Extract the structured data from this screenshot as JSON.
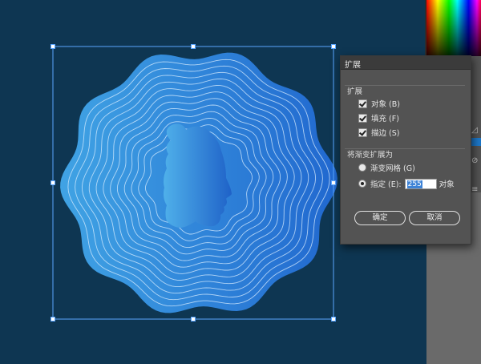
{
  "dialog": {
    "title": "扩展",
    "group_expand": {
      "title": "扩展",
      "options": [
        {
          "label": "对象 (B)",
          "checked": true
        },
        {
          "label": "填充 (F)",
          "checked": true
        },
        {
          "label": "描边 (S)",
          "checked": true
        }
      ]
    },
    "group_gradient": {
      "title": "将渐变扩展为",
      "gradient_mesh_label": "渐变网格 (G)",
      "specify_label": "指定 (E):",
      "specify_value": "255",
      "objects_suffix": "对象",
      "selected": "specify"
    },
    "ok_label": "确定",
    "cancel_label": "取消"
  },
  "artwork": {
    "description_colors": {
      "background": "#0e3652",
      "gradient_start": "#3fa0e3",
      "gradient_end": "#1f6fcf",
      "ring_lines": "#dcefff",
      "selection": "#5aa6ff"
    },
    "ring_count": 12
  },
  "panels": {
    "icons": [
      "triangle-icon",
      "link-icon",
      "list-icon"
    ]
  }
}
